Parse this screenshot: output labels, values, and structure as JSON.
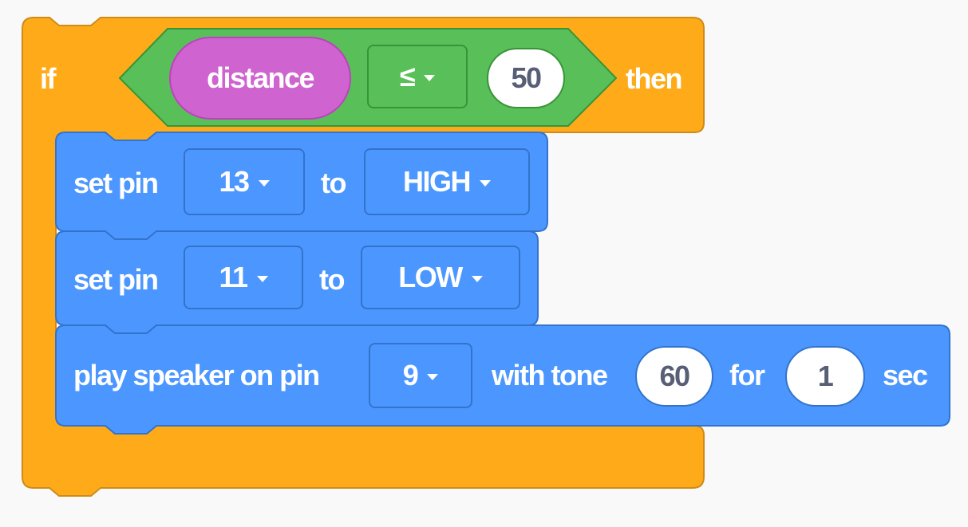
{
  "colors": {
    "control": "#ffab19",
    "control_edge": "#cf8b17",
    "operator": "#59c059",
    "operator_edge": "#389438",
    "sensing": "#cf63cf",
    "motion": "#4c97ff",
    "motion_edge": "#3373cc",
    "background": "#f9f9f9"
  },
  "if_block": {
    "if_label": "if",
    "then_label": "then",
    "condition": {
      "reporter": "distance",
      "operator": "≤",
      "value": "50"
    }
  },
  "statements": [
    {
      "label_1": "set pin",
      "pin": "13",
      "label_2": "to",
      "state": "HIGH"
    },
    {
      "label_1": "set pin",
      "pin": "11",
      "label_2": "to",
      "state": "LOW"
    },
    {
      "label_1": "play speaker on pin",
      "pin": "9",
      "label_2": "with tone",
      "tone": "60",
      "label_3": "for",
      "duration": "1",
      "label_4": "sec"
    }
  ],
  "icons": [
    "dropdown-caret-icon"
  ]
}
